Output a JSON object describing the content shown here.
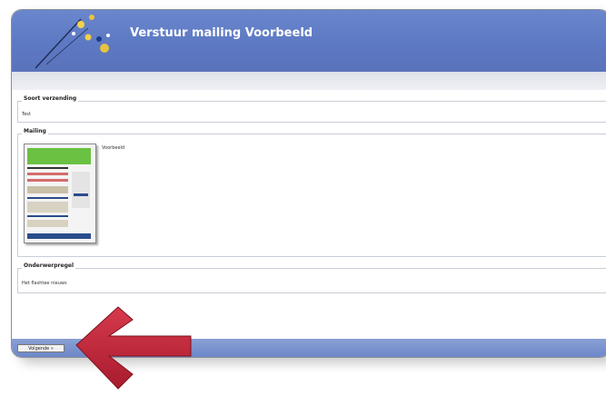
{
  "header": {
    "title": "Verstuur mailing Voorbeeld"
  },
  "sections": {
    "soort_verzending": {
      "label": "Soort verzending",
      "value": "Test"
    },
    "mailing": {
      "label": "Mailing",
      "value": "Voorbeeld"
    },
    "onderwerpregel": {
      "label": "Onderwerpregel",
      "value": "Het flashtee nieuws"
    }
  },
  "footer": {
    "next_label": "Volgende »"
  },
  "colors": {
    "accent": "#5d79c3",
    "arrow": "#c4253a"
  }
}
